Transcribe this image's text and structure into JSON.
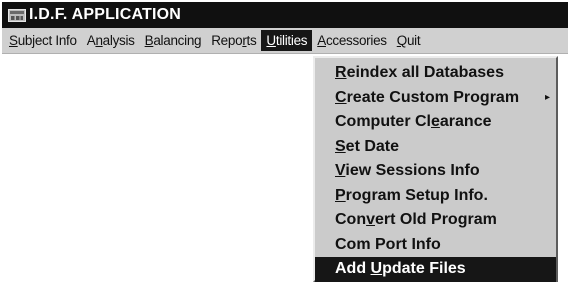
{
  "window": {
    "title": "I.D.F. APPLICATION",
    "icon": "app-window-icon"
  },
  "menubar": {
    "items": [
      {
        "prefix": "",
        "key": "S",
        "suffix": "ubject Info"
      },
      {
        "prefix": "A",
        "key": "n",
        "suffix": "alysis"
      },
      {
        "prefix": "",
        "key": "B",
        "suffix": "alancing"
      },
      {
        "prefix": "Repo",
        "key": "r",
        "suffix": "ts"
      },
      {
        "prefix": "",
        "key": "U",
        "suffix": "tilities"
      },
      {
        "prefix": "",
        "key": "A",
        "suffix": "ccessories"
      },
      {
        "prefix": "",
        "key": "Q",
        "suffix": "uit"
      }
    ],
    "active_index": 4
  },
  "utilities_menu": {
    "items": [
      {
        "prefix": "",
        "key": "R",
        "suffix": "eindex all Databases"
      },
      {
        "prefix": "",
        "key": "C",
        "suffix": "reate Custom Program",
        "submenu_arrow": "▸"
      },
      {
        "prefix": "Computer Cl",
        "key": "e",
        "suffix": "arance"
      },
      {
        "prefix": "",
        "key": "S",
        "suffix": "et Date"
      },
      {
        "prefix": "",
        "key": "V",
        "suffix": "iew Sessions Info"
      },
      {
        "prefix": "",
        "key": "P",
        "suffix": "rogram Setup Info."
      },
      {
        "prefix": "Con",
        "key": "v",
        "suffix": "ert Old Program"
      },
      {
        "prefix": "Com Port Info",
        "key": "",
        "suffix": ""
      },
      {
        "prefix": "Add ",
        "key": "U",
        "suffix": "pdate Files"
      }
    ],
    "highlighted_index": 8
  },
  "colors": {
    "titlebar": "#101010",
    "menubar": "#d0d0d0",
    "menu_panel": "#cbcbcb",
    "highlight": "#161616"
  }
}
